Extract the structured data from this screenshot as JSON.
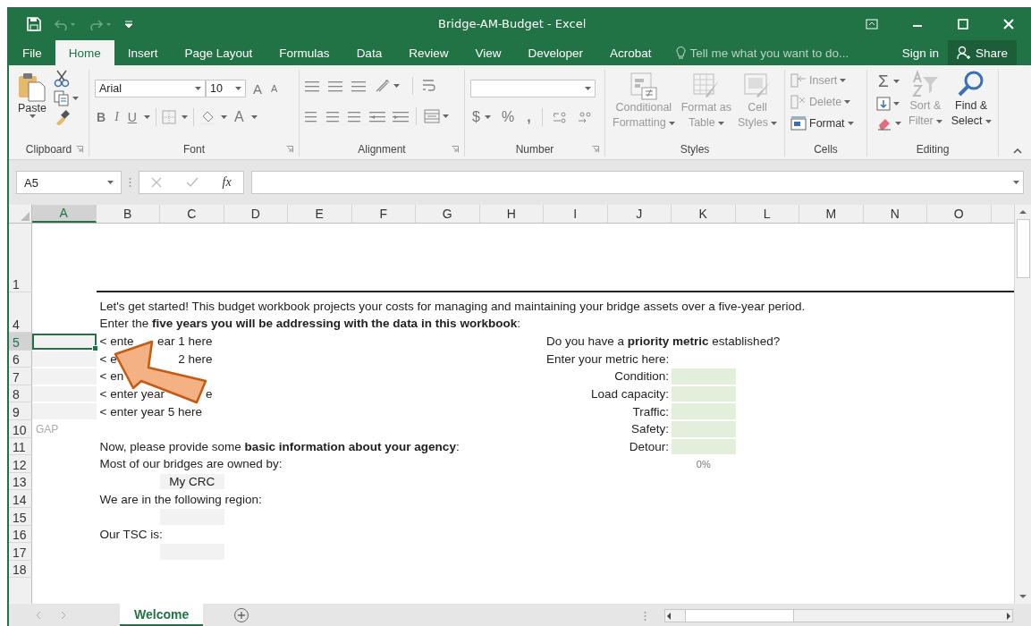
{
  "title_bar": {
    "title": "Bridge-AM-Budget - Excel"
  },
  "ribbon_tabs": [
    {
      "label": "File",
      "selected": false
    },
    {
      "label": "Home",
      "selected": true
    },
    {
      "label": "Insert",
      "selected": false
    },
    {
      "label": "Page Layout",
      "selected": false
    },
    {
      "label": "Formulas",
      "selected": false
    },
    {
      "label": "Data",
      "selected": false
    },
    {
      "label": "Review",
      "selected": false
    },
    {
      "label": "View",
      "selected": false
    },
    {
      "label": "Developer",
      "selected": false
    },
    {
      "label": "Acrobat",
      "selected": false
    }
  ],
  "tell_me": {
    "placeholder": "Tell me what you want to do..."
  },
  "account": {
    "sign_in": "Sign in",
    "share": "Share"
  },
  "ribbon": {
    "clipboard": {
      "label": "Clipboard",
      "paste": "Paste"
    },
    "font": {
      "label": "Font",
      "font_name": "Arial",
      "font_size": "10",
      "grow": "A",
      "shrink": "A",
      "bold": "B",
      "italic": "I",
      "underline": "U",
      "font_color": "A"
    },
    "alignment": {
      "label": "Alignment"
    },
    "number": {
      "label": "Number",
      "currency": "$",
      "percent": "%",
      "comma": ","
    },
    "styles": {
      "label": "Styles",
      "buttons": [
        {
          "lines": [
            "Conditional",
            "Formatting"
          ],
          "disabled": true
        },
        {
          "lines": [
            "Format as",
            "Table"
          ],
          "disabled": true
        },
        {
          "lines": [
            "Cell",
            "Styles"
          ],
          "disabled": true
        }
      ]
    },
    "cells": {
      "label": "Cells",
      "buttons": [
        {
          "label": "Insert",
          "disabled": true
        },
        {
          "label": "Delete",
          "disabled": true
        },
        {
          "label": "Format",
          "disabled": false
        }
      ]
    },
    "editing": {
      "label": "Editing",
      "sum": "Σ",
      "buttons": [
        {
          "lines": [
            "Sort &",
            "Filter"
          ],
          "disabled": true
        },
        {
          "lines": [
            "Find &",
            "Select"
          ],
          "disabled": false
        }
      ]
    }
  },
  "formula_bar": {
    "name_box": "A5",
    "function": "fx"
  },
  "columns": [
    {
      "label": "A",
      "selected": true
    },
    {
      "label": "B",
      "selected": false
    },
    {
      "label": "C",
      "selected": false
    },
    {
      "label": "D",
      "selected": false
    },
    {
      "label": "E",
      "selected": false
    },
    {
      "label": "F",
      "selected": false
    },
    {
      "label": "G",
      "selected": false
    },
    {
      "label": "H",
      "selected": false
    },
    {
      "label": "I",
      "selected": false
    },
    {
      "label": "J",
      "selected": false
    },
    {
      "label": "K",
      "selected": false
    },
    {
      "label": "L",
      "selected": false
    },
    {
      "label": "M",
      "selected": false
    },
    {
      "label": "N",
      "selected": false
    },
    {
      "label": "O",
      "selected": false
    }
  ],
  "rows": [
    {
      "header": "1",
      "selected": false,
      "kind": "banner"
    },
    {
      "header": "4",
      "selected": false,
      "kind": "intro",
      "lines": [
        "Let's get started! This budget workbook projects your costs for managing and maintaining your bridge assets over a five-year period.",
        "Enter the **five years you will be addressing with the data in this workbook**:"
      ]
    },
    {
      "header": "5",
      "selected": true,
      "kind": "year",
      "prompt": [
        "< ente",
        "ear 1 here"
      ],
      "right_text": "Do you have a **priority metric** established?"
    },
    {
      "header": "6",
      "selected": false,
      "kind": "year",
      "prompt": [
        "< e",
        "2 here"
      ],
      "right_text": "Enter your metric here:"
    },
    {
      "header": "7",
      "selected": false,
      "kind": "year",
      "prompt": [
        "< en"
      ],
      "metric": "Condition:"
    },
    {
      "header": "8",
      "selected": false,
      "kind": "year",
      "prompt": [
        "< enter year",
        "e"
      ],
      "metric": "Load capacity:"
    },
    {
      "header": "9",
      "selected": false,
      "kind": "year",
      "prompt": [
        "< enter year 5 here"
      ],
      "metric": "Traffic:"
    },
    {
      "header": "10",
      "selected": false,
      "kind": "text",
      "faint_text": "GAP",
      "metric": "Safety:"
    },
    {
      "header": "11",
      "selected": false,
      "kind": "text",
      "text": "Now, please provide some **basic information about your agency**:",
      "metric": "Detour:"
    },
    {
      "header": "12",
      "selected": false,
      "kind": "text",
      "text": "Most of our bridges are owned by:",
      "metric_total": "0%"
    },
    {
      "header": "13",
      "selected": false,
      "kind": "field",
      "value": "My CRC"
    },
    {
      "header": "14",
      "selected": false,
      "kind": "text",
      "text": "We are in the following region:"
    },
    {
      "header": "15",
      "selected": false,
      "kind": "field"
    },
    {
      "header": "16",
      "selected": false,
      "kind": "text",
      "text": "Our TSC is:"
    },
    {
      "header": "17",
      "selected": false,
      "kind": "field"
    },
    {
      "header": "18",
      "selected": false,
      "kind": "blank"
    }
  ],
  "sheet_tabs": [
    {
      "label": "Welcome",
      "selected": true
    }
  ]
}
